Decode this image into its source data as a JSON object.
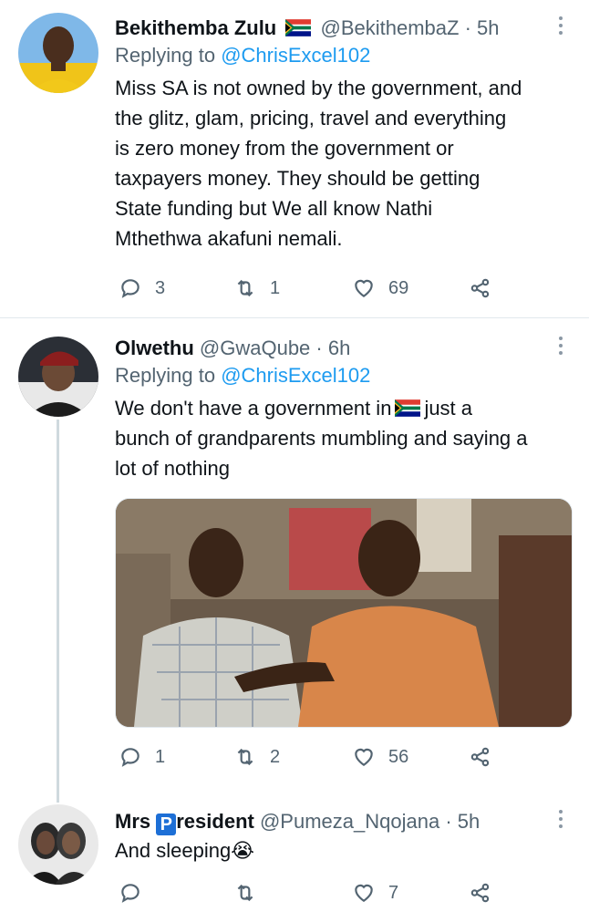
{
  "tweets": [
    {
      "name": "Bekithemba Zulu",
      "handle": "@BekithembaZ",
      "dot": "·",
      "time": "5h",
      "replying_prefix": "Replying to",
      "replying_to": "@ChrisExcel102",
      "lines": [
        "Miss SA is not owned by the government, and",
        "the glitz, glam, pricing, travel and everything",
        "is zero money from the government or",
        "taxpayers money. They should be getting",
        "State funding but We all know Nathi",
        "Mthethwa akafuni nemali."
      ],
      "replies": "3",
      "retweets": "1",
      "likes": "69"
    },
    {
      "name": "Olwethu",
      "handle": "@GwaQube",
      "dot": "·",
      "time": "6h",
      "replying_prefix": "Replying to",
      "replying_to": "@ChrisExcel102",
      "line1_a": "We don't have a government in",
      "line1_b": "just a",
      "line2": "bunch of grandparents mumbling and saying a",
      "line3": "lot of nothing",
      "replies": "1",
      "retweets": "2",
      "likes": "56"
    },
    {
      "name_a": "Mrs",
      "name_badge": "P",
      "name_b": "resident",
      "handle": "@Pumeza_Nqojana",
      "dot": "·",
      "time": "5h",
      "text": "And sleeping😭",
      "replies": "",
      "retweets": "",
      "likes": "7"
    }
  ],
  "icons": [
    "reply-icon",
    "retweet-icon",
    "like-icon",
    "share-icon",
    "more-icon",
    "south-africa-flag-icon"
  ],
  "colors": {
    "link": "#1d9bf0",
    "muted": "#536471",
    "divider": "#e1e8ed",
    "text": "#0f1419"
  }
}
